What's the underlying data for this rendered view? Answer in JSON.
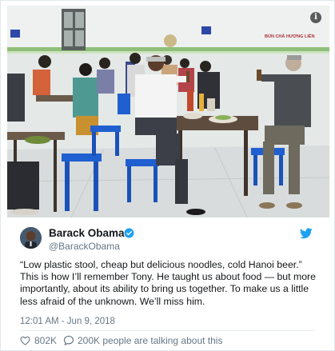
{
  "tweet": {
    "author_name": "Barack Obama",
    "author_handle": "@BarackObama",
    "text": "“Low plastic stool, cheap but delicious noodles, cold Hanoi beer.” This is how I’ll remember Tony. He taught us about food — but more importantly, about its ability to bring us together. To make us a little less afraid of the unknown. We’ll miss him.",
    "timestamp": "12:01 AM - Jun 9, 2018",
    "likes": "802K",
    "talking": "200K people are talking about this"
  },
  "photo": {
    "sign_text": "BÚN CHẢ HƯƠNG LIÊN"
  },
  "icons": {
    "verified": "verified-badge-icon",
    "brand": "twitter-bird-icon",
    "like": "heart-icon",
    "reply": "reply-bubble-icon",
    "info": "info-icon"
  },
  "colors": {
    "accent": "#1da1f2",
    "secondary_text": "#657786",
    "stool_blue": "#1f5fd0"
  }
}
